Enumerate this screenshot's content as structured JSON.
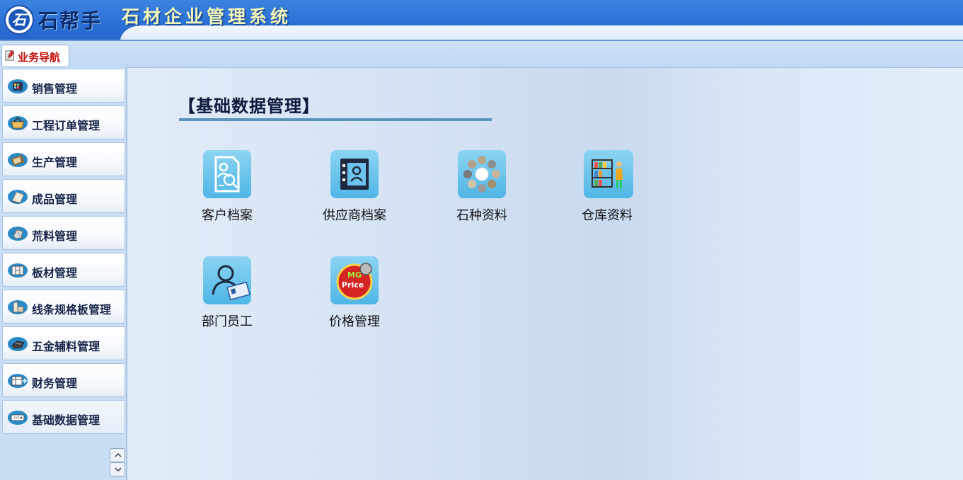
{
  "header": {
    "logo_glyph": "石",
    "brand": "石帮手",
    "system_title": "石材企业管理系统"
  },
  "tabs": [
    {
      "label": "业务导航",
      "active": true
    }
  ],
  "sidebar": {
    "items": [
      {
        "label": "销售管理",
        "icon": "sales-icon"
      },
      {
        "label": "工程订单管理",
        "icon": "basket-icon"
      },
      {
        "label": "生产管理",
        "icon": "production-icon"
      },
      {
        "label": "成品管理",
        "icon": "finished-goods-icon"
      },
      {
        "label": "荒料管理",
        "icon": "raw-block-icon"
      },
      {
        "label": "板材管理",
        "icon": "slab-icon"
      },
      {
        "label": "线条规格板管理",
        "icon": "moulding-icon"
      },
      {
        "label": "五金辅料管理",
        "icon": "hardware-icon"
      },
      {
        "label": "财务管理",
        "icon": "finance-icon"
      },
      {
        "label": "基础数据管理",
        "icon": "base-data-icon",
        "active": true
      }
    ]
  },
  "main": {
    "section_title": "【基础数据管理】",
    "tiles": [
      {
        "label": "客户档案",
        "icon": "customer-file-icon"
      },
      {
        "label": "供应商档案",
        "icon": "supplier-file-icon"
      },
      {
        "label": "石种资料",
        "icon": "stone-type-icon"
      },
      {
        "label": "仓库资料",
        "icon": "warehouse-icon"
      },
      {
        "label": "部门员工",
        "icon": "employee-icon"
      },
      {
        "label": "价格管理",
        "icon": "price-icon",
        "badge_text": "Price",
        "badge_top": "MG"
      }
    ]
  },
  "colors": {
    "header_blue": "#2b70d6",
    "title_yellow": "#f5f7b8",
    "tab_red": "#c30d0d",
    "tile_blue": "#4fb6e6",
    "menu_text": "#18254a"
  }
}
